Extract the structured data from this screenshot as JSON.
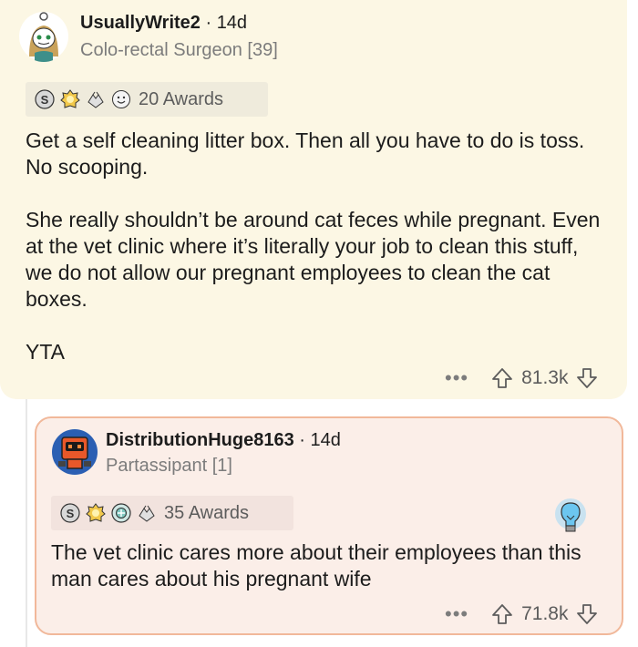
{
  "comment1": {
    "username": "UsuallyWrite2",
    "age": "14d",
    "flair": "Colo-rectal Surgeon [39]",
    "awards_label": "20 Awards",
    "award_icons": [
      "silver-award-icon",
      "gold-award-icon",
      "hands-award-icon",
      "smile-award-icon"
    ],
    "paragraphs": [
      "Get a self cleaning litter box. Then all you have to do is toss. No scooping.",
      "She really shouldn’t be around cat feces while pregnant. Even at the vet clinic where it’s literally your job to clean this stuff, we do not allow our pregnant employees to clean the cat boxes.",
      "YTA"
    ],
    "more": "•••",
    "score": "81.3k"
  },
  "comment2": {
    "username": "DistributionHuge8163",
    "age": "14d",
    "flair": "Partassipant [1]",
    "awards_label": "35 Awards",
    "award_icons": [
      "silver-award-icon",
      "gold-award-icon",
      "platinum-award-icon",
      "hands-award-icon"
    ],
    "paragraphs": [
      "The vet clinic cares more about their employees than this man cares about his pregnant wife"
    ],
    "more": "•••",
    "score": "71.8k"
  },
  "colors": {
    "card1_bg": "#fcf7e4",
    "card2_bg": "#fbeee8",
    "card2_border": "#f1b89a",
    "muted": "#7c7c7c"
  }
}
